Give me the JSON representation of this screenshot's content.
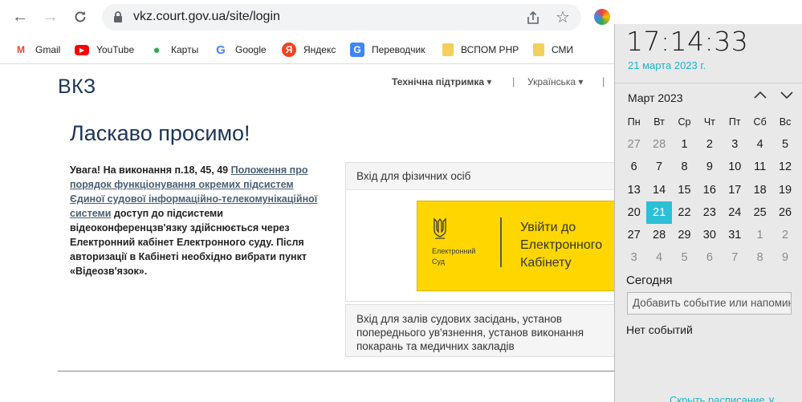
{
  "browser": {
    "url": "vkz.court.gov.ua/site/login",
    "bookmarks": [
      {
        "label": "Gmail",
        "icon": "gmail-icon",
        "color": "#ea4335"
      },
      {
        "label": "YouTube",
        "icon": "youtube-icon",
        "color": "#ff0000"
      },
      {
        "label": "Карты",
        "icon": "maps-icon",
        "color": "#34a853"
      },
      {
        "label": "Google",
        "icon": "google-icon",
        "color": "#4285f4"
      },
      {
        "label": "Яндекс",
        "icon": "yandex-icon",
        "color": "#fc3f1d"
      },
      {
        "label": "Переводчик",
        "icon": "translate-icon",
        "color": "#4285f4"
      },
      {
        "label": "ВСПОМ РНР",
        "icon": "folder-icon",
        "color": "#f4cf5c"
      },
      {
        "label": "СМИ",
        "icon": "folder-icon",
        "color": "#f4cf5c"
      }
    ]
  },
  "page": {
    "logo": "ВКЗ",
    "support": "Технічна підтримка",
    "language": "Українська",
    "welcome": "Ласкаво просимо!",
    "notice_prefix": "Увага! На виконання п.18, 45, 49 ",
    "notice_link": "Положення про порядок функціонування окремих підсистем Єдиної судової інформаційно-телекомунікаційної системи",
    "notice_suffix": " доступ до підсистеми відеоконференцзв'язку здійснюється через Електронний кабінет Електронного суду. Після авторизації в Кабінеті необхідно вибрати пункт «Відеозв'язок».",
    "individuals_header": "Вхід для фізичних осіб",
    "ecourt_brand_line1": "Електронний",
    "ecourt_brand_line2": "Суд",
    "ecourt_enter": "Увійти до Електронного Кабінету",
    "halls_text": "Вхід для залів судових засідань, установ попереднього ув'язнення, установ виконання покарань та медичних закладів"
  },
  "calendar": {
    "time": "17:14:33",
    "date": "21 марта 2023 г.",
    "month": "Март 2023",
    "weekdays": [
      "Пн",
      "Вт",
      "Ср",
      "Чт",
      "Пт",
      "Сб",
      "Вс"
    ],
    "weeks": [
      [
        "27",
        "28",
        "1",
        "2",
        "3",
        "4",
        "5"
      ],
      [
        "6",
        "7",
        "8",
        "9",
        "10",
        "11",
        "12"
      ],
      [
        "13",
        "14",
        "15",
        "16",
        "17",
        "18",
        "19"
      ],
      [
        "20",
        "21",
        "22",
        "23",
        "24",
        "25",
        "26"
      ],
      [
        "27",
        "28",
        "29",
        "30",
        "31",
        "1",
        "2"
      ],
      [
        "3",
        "4",
        "5",
        "6",
        "7",
        "8",
        "9"
      ]
    ],
    "today_label": "Сегодня",
    "event_placeholder": "Добавить событие или напоминание",
    "no_events": "Нет событий",
    "hide_schedule": "Скрыть расписание",
    "accent": "#2bc0d6"
  }
}
